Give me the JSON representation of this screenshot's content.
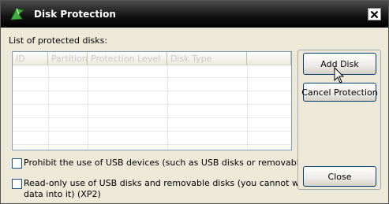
{
  "window": {
    "title": "Disk Protection",
    "icon": "green-bird-icon",
    "close_icon": "close-icon"
  },
  "list": {
    "label": "List of protected disks:",
    "columns": [
      "ID",
      "Partition",
      "Protection Level",
      "Disk Type",
      ""
    ],
    "rows": []
  },
  "buttons": {
    "add_disk": "Add Disk",
    "cancel_protection": "Cancel Protection",
    "close": "Close"
  },
  "options": {
    "prohibit_usb": {
      "label": "Prohibit the use of USB devices (such as USB disks or removable disks)",
      "checked": false
    },
    "readonly_usb": {
      "label_line1": "Read-only use of USB disks and removable disks (you cannot write",
      "label_line2": "data into it) (XP2)",
      "checked": false
    }
  },
  "colors": {
    "titlebar": "#000000",
    "background": "#ece9d8",
    "button_border": "#003c74",
    "checkbox_border": "#1c5180"
  }
}
